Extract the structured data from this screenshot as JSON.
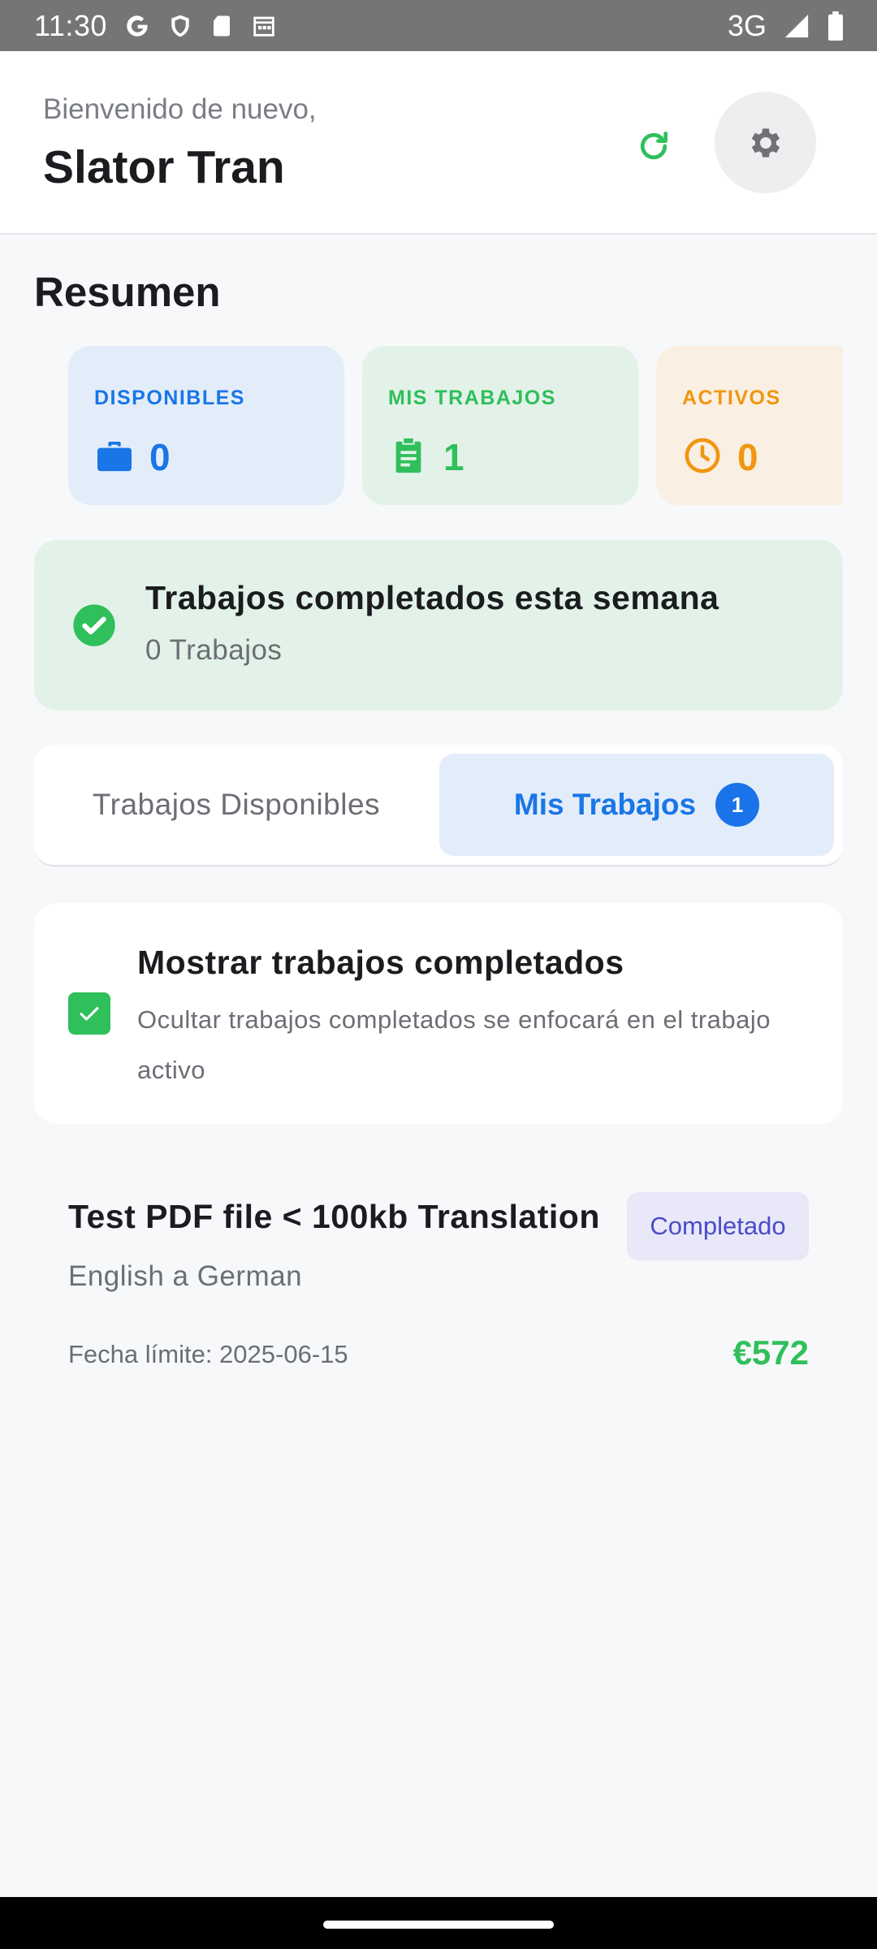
{
  "status_bar": {
    "time": "11:30",
    "network": "3G",
    "icons": [
      "google-icon",
      "shield-icon",
      "sd-card-icon",
      "calendar-icon",
      "signal-icon",
      "battery-icon"
    ]
  },
  "header": {
    "welcome": "Bienvenido de nuevo,",
    "user_name": "Slator Tran",
    "icons": [
      "refresh-icon",
      "gear-icon"
    ]
  },
  "summary": {
    "title": "Resumen",
    "cards": [
      {
        "label": "DISPONIBLES",
        "value": "0",
        "icon": "briefcase-icon",
        "color": "#1976e6"
      },
      {
        "label": "MIS TRABAJOS",
        "value": "1",
        "icon": "clipboard-icon",
        "color": "#2fbf5b"
      },
      {
        "label": "ACTIVOS",
        "value": "0",
        "icon": "clock-icon",
        "color": "#f0960f"
      }
    ]
  },
  "week_banner": {
    "title": "Trabajos completados esta semana",
    "subtitle": "0 Trabajos",
    "icon": "check-circle-icon"
  },
  "tabs": {
    "available_label": "Trabajos Disponibles",
    "mine_label": "Mis Trabajos",
    "mine_badge": "1",
    "active": "mine"
  },
  "filter": {
    "title": "Mostrar trabajos completados",
    "description": "Ocultar trabajos completados se enfocará en el trabajo activo",
    "checked": true
  },
  "jobs": [
    {
      "title": "Test PDF file < 100kb Translation",
      "status": "Completado",
      "languages": "English a German",
      "deadline": "Fecha límite: 2025-06-15",
      "price": "€572"
    }
  ],
  "colors": {
    "accent_blue": "#1976e6",
    "accent_green": "#2fbf5b",
    "accent_orange": "#f0960f",
    "status_purple": "#4a4bc9"
  }
}
